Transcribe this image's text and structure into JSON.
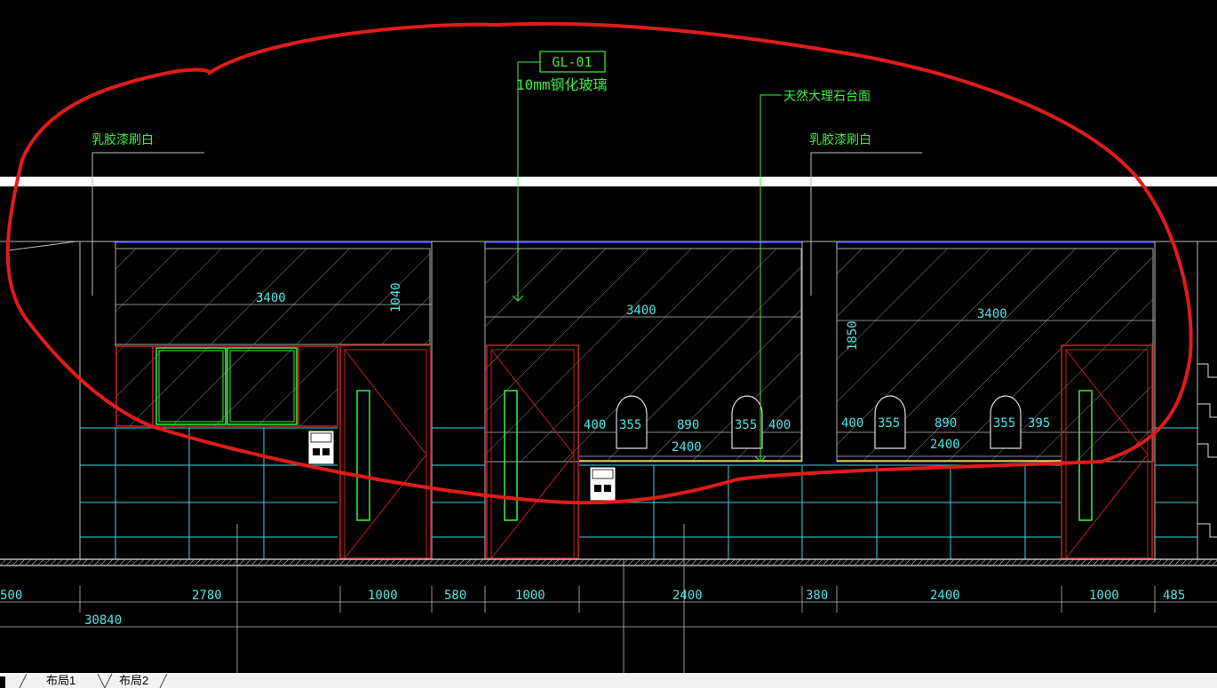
{
  "annotations": {
    "glass_code": "GL-01",
    "glass_desc": "10mm钢化玻璃",
    "marble": "天然大理石台面",
    "paint_left": "乳胶漆刷白",
    "paint_right": "乳胶漆刷白"
  },
  "dims": {
    "upper": [
      "3400",
      "1040",
      "3400",
      "3400",
      "1850"
    ],
    "arches_mid": [
      "400",
      "355",
      "890",
      "355",
      "400"
    ],
    "arches_right": [
      "400",
      "355",
      "890",
      "355",
      "395"
    ],
    "counters": [
      "2400",
      "2400"
    ],
    "bottom": [
      "500",
      "2780",
      "1000",
      "580",
      "1000",
      "2400",
      "380",
      "2400",
      "1000",
      "485"
    ],
    "total": "30840"
  },
  "tabs": [
    "布局1",
    "布局2"
  ],
  "colors": {
    "markup": "#e01b1b",
    "annotation": "#3cf03c",
    "dimension": "#4fe6e6",
    "frame": "#c82020",
    "ceiling": "#2233dd"
  }
}
